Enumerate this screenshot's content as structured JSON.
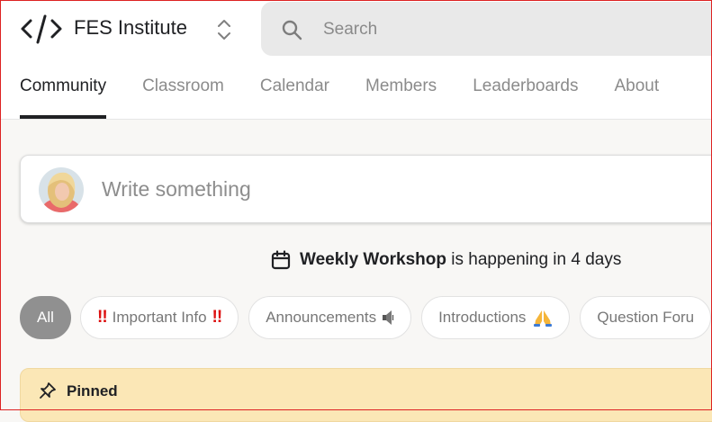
{
  "header": {
    "brand_name": "FES Institute",
    "search_placeholder": "Search",
    "tabs": [
      {
        "label": "Community",
        "active": true
      },
      {
        "label": "Classroom"
      },
      {
        "label": "Calendar"
      },
      {
        "label": "Members"
      },
      {
        "label": "Leaderboards"
      },
      {
        "label": "About"
      }
    ]
  },
  "composer": {
    "placeholder": "Write something"
  },
  "event": {
    "name": "Weekly Workshop",
    "text": "is happening in 4 days"
  },
  "filters": [
    {
      "label": "All",
      "active": true
    },
    {
      "label": "Important Info",
      "prefix": "!!",
      "suffix": "!!"
    },
    {
      "label": "Announcements",
      "icon": "speaker-icon"
    },
    {
      "label": "Introductions",
      "icon": "praying-hands-icon"
    },
    {
      "label": "Question Foru"
    }
  ],
  "pinned": {
    "label": "Pinned"
  },
  "colors": {
    "active_tab": "#202124",
    "active_chip": "#909090",
    "pinned_bg": "#fbe7b6",
    "important_red": "#dd1111"
  }
}
